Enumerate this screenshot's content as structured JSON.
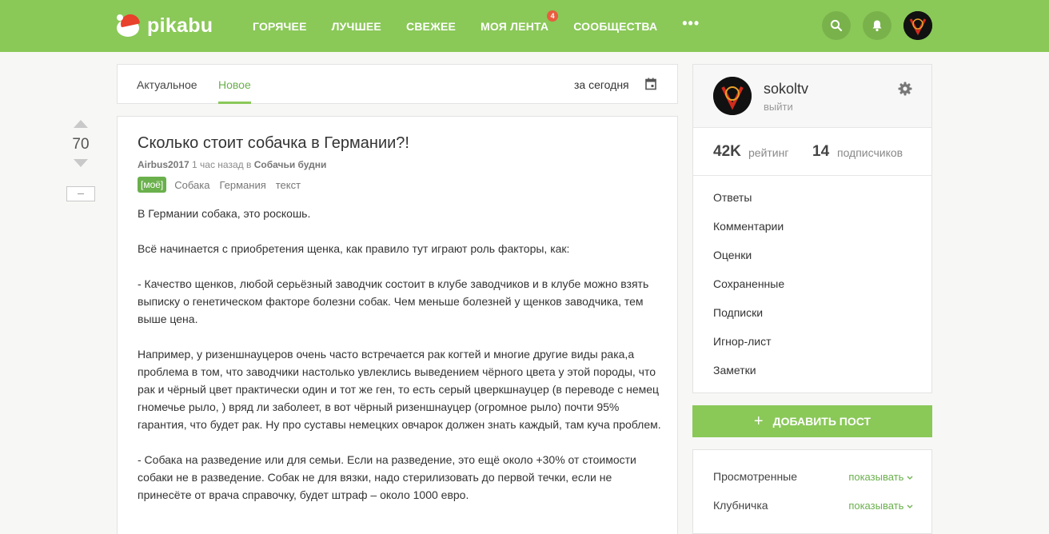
{
  "header": {
    "logo_text": "pikabu",
    "nav": [
      {
        "label": "ГОРЯЧЕЕ"
      },
      {
        "label": "ЛУЧШЕЕ"
      },
      {
        "label": "СВЕЖЕЕ"
      },
      {
        "label": "МОЯ ЛЕНТА",
        "badge": "4"
      },
      {
        "label": "СООБЩЕСТВА"
      }
    ],
    "more_label": "•••",
    "colors": {
      "brand": "#8ac858",
      "badge": "#e85d3f"
    }
  },
  "feed_tabs": {
    "items": [
      {
        "label": "Актуальное"
      },
      {
        "label": "Новое"
      }
    ],
    "active": "Новое",
    "period_label": "за сегодня"
  },
  "vote": {
    "count": "70"
  },
  "post": {
    "title": "Сколько стоит собачка в Германии?!",
    "author": "Airbus2017",
    "time": " 1 час назад в ",
    "community": "Собачьи будни",
    "own_tag": "[моё]",
    "tags": [
      "Собака",
      "Германия",
      "текст"
    ],
    "paragraphs": [
      "В Германии собака, это роскошь.",
      "Всё начинается с приобретения щенка, как правило тут играют роль факторы, как:",
      "- Качество щенков, любой серьёзный заводчик состоит в клубе заводчиков и в клубе можно взять выписку о генетическом факторе болезни собак. Чем меньше болезней у щенков заводчика, тем выше цена.",
      "Например, у ризеншнауцеров очень часто встречается рак когтей и многие другие виды рака,а проблема в том, что заводчики настолько увлеклись выведением чёрного цвета у этой породы, что рак и чёрный цвет практически один и тот же ген, то есть серый цверкшнауцер (в переводе с немец гномечье рыло, ) вряд ли заболеет, в вот чёрный ризеншнауцер (огромное рыло) почти 95% гарантия, что будет рак. Ну про суставы немецких овчарок должен знать каждый, там куча проблем.",
      "- Собака на разведение или для семьи. Если на разведение, это ещё около +30% от стоимости собаки не в разведение. Собак не для вязки, надо стерилизовать до первой течки, если не принесёте от врача справочку, будет штраф – около 1000 евро."
    ]
  },
  "profile": {
    "name": "sokoltv",
    "logout": "выйти",
    "rating_value": "42K",
    "rating_label": "рейтинг",
    "subscribers_value": "14",
    "subscribers_label": "подписчиков",
    "menu": [
      "Ответы",
      "Комментарии",
      "Оценки",
      "Сохраненные",
      "Подписки",
      "Игнор-лист",
      "Заметки"
    ]
  },
  "add_post": {
    "plus": "+",
    "label": "ДОБАВИТЬ ПОСТ"
  },
  "filters": [
    {
      "label": "Просмотренные",
      "value": "показывать"
    },
    {
      "label": "Клубничка",
      "value": "показывать"
    }
  ],
  "icons": [
    "search-icon",
    "bell-icon",
    "calendar-icon",
    "gear-icon",
    "chevron-down-icon",
    "arrow-up-icon",
    "arrow-down-icon"
  ]
}
